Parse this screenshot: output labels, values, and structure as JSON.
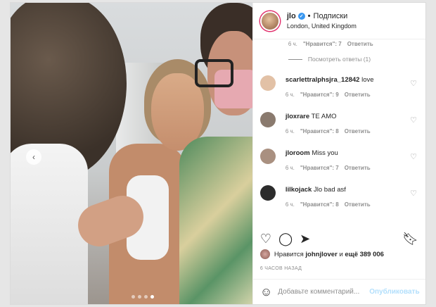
{
  "post": {
    "username": "jlo",
    "separator": "•",
    "follow_label": "Подписки",
    "location": "London, United Kingdom"
  },
  "prev_comment_meta": {
    "time": "6 ч.",
    "likes": "\"Нравится\": 7",
    "reply": "Ответить"
  },
  "view_replies": "Посмотреть ответы (1)",
  "comments": [
    {
      "user": "scarlettralphsjra_12842",
      "text": " love",
      "time": "6 ч.",
      "likes": "\"Нравится\": 9",
      "reply": "Ответить",
      "avatar_color": "#e2c1a6"
    },
    {
      "user": "jloxrare",
      "text": "TE AMO",
      "time": "6 ч.",
      "likes": "\"Нравится\": 8",
      "reply": "Ответить",
      "avatar_color": "#8a7a6e"
    },
    {
      "user": "jloroom",
      "text": "Miss you",
      "time": "6 ч.",
      "likes": "\"Нравится\": 7",
      "reply": "Ответить",
      "avatar_color": "#a99080"
    },
    {
      "user": "lilkojack",
      "text": "Jlo bad asf",
      "time": "6 ч.",
      "likes": "\"Нравится\": 8",
      "reply": "Ответить",
      "avatar_color": "#2c2c2c"
    }
  ],
  "likes_line": {
    "prefix": "Нравится",
    "user": "johnjlover",
    "middle": "и",
    "count": "ещё 389 006"
  },
  "timestamp": "6 ЧАСОВ НАЗАД",
  "add_comment": {
    "placeholder": "Добавьте комментарий...",
    "publish_label": "Опубликовать"
  },
  "icons": {
    "like": "heart-icon",
    "comment": "comment-icon",
    "share": "share-icon",
    "save": "bookmark-icon",
    "emoji": "emoji-icon"
  },
  "colors": {
    "link_blue": "#3897f0",
    "publish_disabled": "#b2dffc",
    "muted": "#8e8e8e"
  }
}
